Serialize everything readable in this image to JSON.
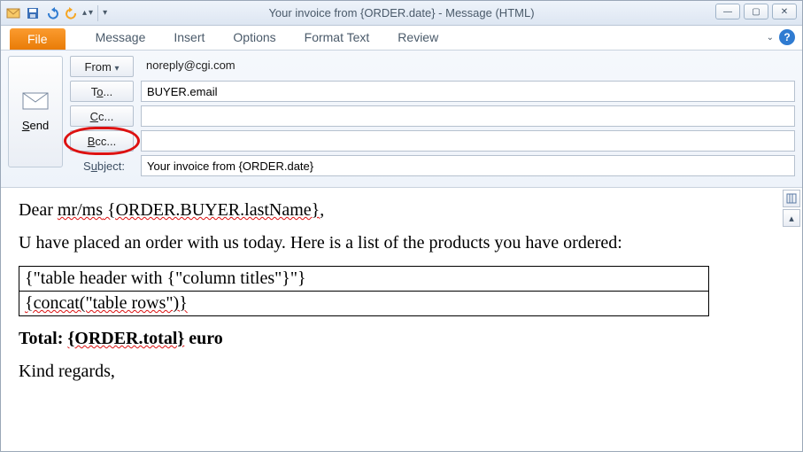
{
  "window": {
    "title": "Your invoice from {ORDER.date}  -  Message (HTML)"
  },
  "qat": {
    "save": "save",
    "undo": "undo",
    "redo": "redo"
  },
  "ribbon": {
    "file": "File",
    "tabs": [
      "Message",
      "Insert",
      "Options",
      "Format Text",
      "Review"
    ]
  },
  "send": {
    "label": "Send"
  },
  "fields": {
    "from_button": "From",
    "from_value": "noreply@cgi.com",
    "to_button": "To...",
    "to_value": "BUYER.email",
    "cc_button": "Cc...",
    "cc_value": "",
    "bcc_button": "Bcc...",
    "bcc_value": "",
    "subject_label": "Subject:",
    "subject_value": "Your invoice from {ORDER.date}"
  },
  "body": {
    "greeting_prefix": "Dear ",
    "greeting_title": "mr/ms",
    "greeting_name": " {ORDER.BUYER.lastName}",
    "greeting_suffix": ",",
    "line1": "U have placed an order with us today. Here is a list of the products you have ordered:",
    "table_row1": "{\"table header with {\"column titles\"}\"}",
    "table_row2": "{concat(\"table rows\")}",
    "total_label": "Total: ",
    "total_value": "{ORDER.total}",
    "total_suffix": " euro",
    "signoff": "Kind regards,"
  }
}
